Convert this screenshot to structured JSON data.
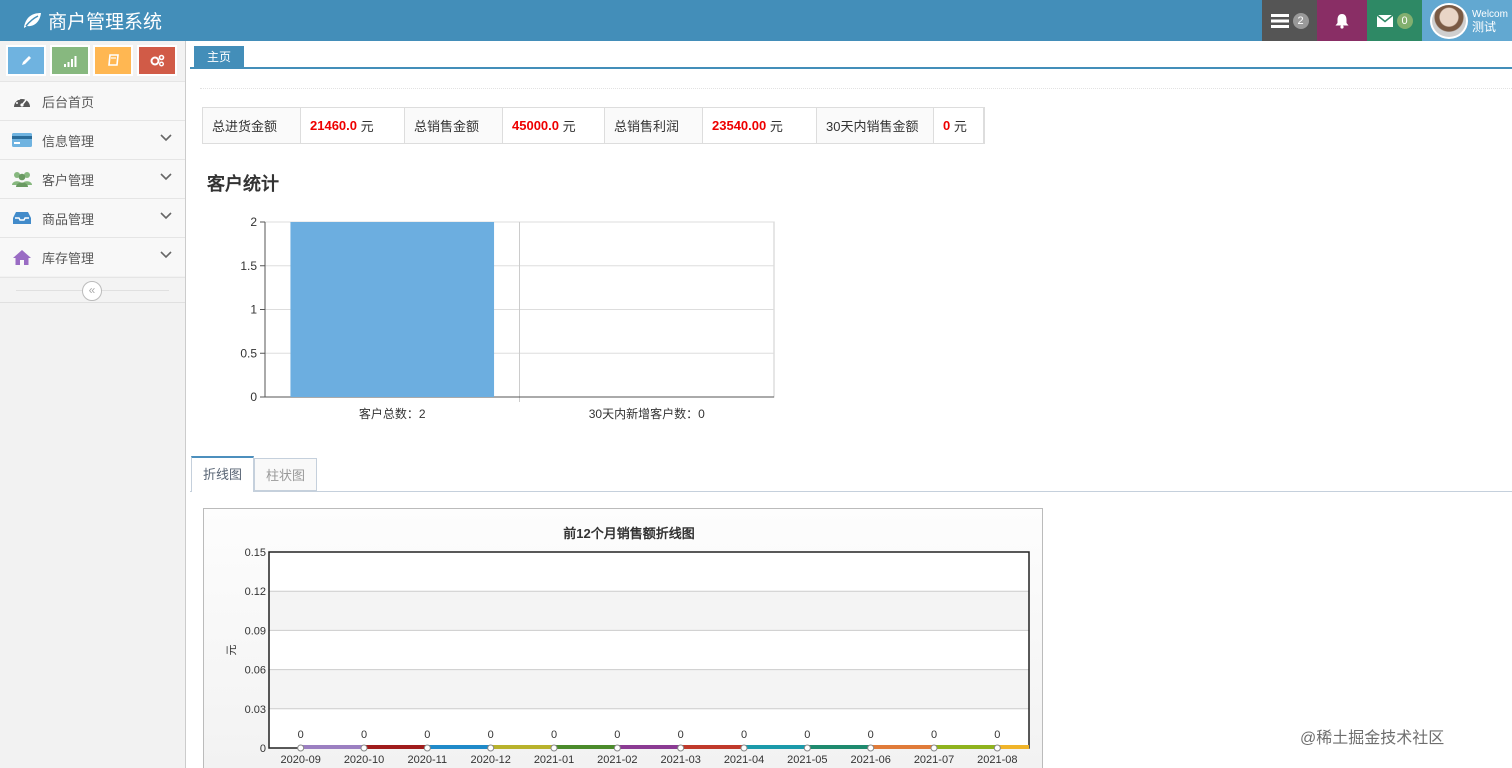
{
  "navbar": {
    "brand": "商户管理系统",
    "tasks_badge": "2",
    "messages_badge": "0",
    "user_welcome": "Welcome",
    "user_name": "测试"
  },
  "sidebar": {
    "items": [
      {
        "label": "后台首页",
        "icon": "dashboard-icon",
        "color": "#585858"
      },
      {
        "label": "信息管理",
        "icon": "credit-card-icon",
        "color": "#6fb3e0"
      },
      {
        "label": "客户管理",
        "icon": "users-icon",
        "color": "#87b87f"
      },
      {
        "label": "商品管理",
        "icon": "inbox-icon",
        "color": "#428bca"
      },
      {
        "label": "库存管理",
        "icon": "home-icon",
        "color": "#9a6cc4"
      }
    ],
    "shortcuts": [
      "pencil-icon",
      "signal-icon",
      "book-icon",
      "cogs-icon"
    ],
    "collapse_label": "«"
  },
  "main_tab": "主页",
  "stats": [
    {
      "label": "总进货金额",
      "value": "21460.0",
      "unit": "元"
    },
    {
      "label": "总销售金额",
      "value": "45000.0",
      "unit": "元"
    },
    {
      "label": "总销售利润",
      "value": "23540.00",
      "unit": "元"
    },
    {
      "label": "30天内销售金额",
      "value": "0",
      "unit": "元"
    }
  ],
  "section_title": "客户统计",
  "subtabs": [
    "折线图",
    "柱状图"
  ],
  "watermark": "@稀土掘金技术社区",
  "chart_data": [
    {
      "type": "bar",
      "categories": [
        "客户总数：2",
        "30天内新增客户数：0"
      ],
      "values": [
        2,
        0
      ],
      "ylim": [
        0,
        2
      ],
      "yticks": [
        "0",
        "0.5",
        "1",
        "1.5",
        "2"
      ],
      "grid": true,
      "color": "#6caee0"
    },
    {
      "type": "line",
      "title": "前12个月销售额折线图",
      "ylabel": "元",
      "categories": [
        "2020-09",
        "2020-10",
        "2020-11",
        "2020-12",
        "2021-01",
        "2021-02",
        "2021-03",
        "2021-04",
        "2021-05",
        "2021-06",
        "2021-07",
        "2021-08"
      ],
      "values": [
        0,
        0,
        0,
        0,
        0,
        0,
        0,
        0,
        0,
        0,
        0,
        0
      ],
      "value_labels": [
        "0",
        "0",
        "0",
        "0",
        "0",
        "0",
        "0",
        "0",
        "0",
        "0",
        "0",
        "0"
      ],
      "ylim": [
        0,
        0.15
      ],
      "yticks": [
        "0",
        "0.03",
        "0.06",
        "0.09",
        "0.12",
        "0.15"
      ],
      "grid": true,
      "segment_colors": [
        "#9b7fc1",
        "#a01c1c",
        "#1f8ac9",
        "#b8b22c",
        "#4b8b2b",
        "#8b3b93",
        "#c0392b",
        "#1b9aaa",
        "#1e8a6e",
        "#e07b39",
        "#8fb31d",
        "#f0b429"
      ]
    }
  ]
}
